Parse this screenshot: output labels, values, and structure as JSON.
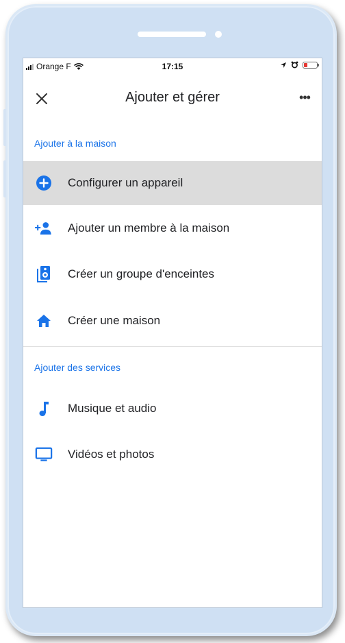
{
  "statusbar": {
    "carrier": "Orange F",
    "time": "17:15"
  },
  "appbar": {
    "title": "Ajouter et gérer",
    "more": "•••"
  },
  "sections": {
    "add_home": {
      "header": "Ajouter à la maison",
      "items": [
        {
          "label": "Configurer un appareil",
          "icon": "add-circle-icon"
        },
        {
          "label": "Ajouter un membre à la maison",
          "icon": "add-person-icon"
        },
        {
          "label": "Créer un groupe d'enceintes",
          "icon": "speaker-group-icon"
        },
        {
          "label": "Créer une maison",
          "icon": "home-icon"
        }
      ]
    },
    "add_services": {
      "header": "Ajouter des services",
      "items": [
        {
          "label": "Musique et audio",
          "icon": "music-note-icon"
        },
        {
          "label": "Vidéos et photos",
          "icon": "tv-icon"
        }
      ]
    }
  },
  "colors": {
    "accent": "#1a73e8",
    "selected_bg": "#dcdcdc",
    "frame": "#cfe0f3"
  }
}
